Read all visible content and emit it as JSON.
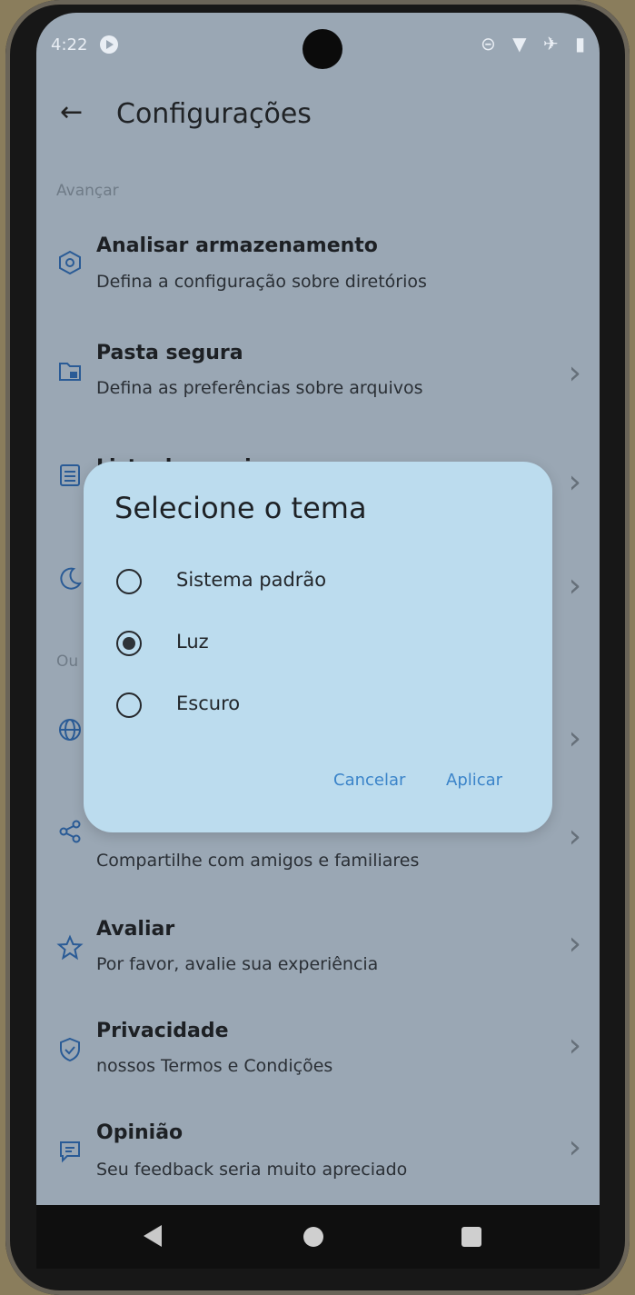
{
  "status": {
    "time": "4:22",
    "icons": "⊝ ▼ ✈ ▮"
  },
  "appbar": {
    "back": "←",
    "title": "Configurações"
  },
  "sections": {
    "advanced": "Avançar",
    "others": "Ou"
  },
  "rows": [
    {
      "title": "Analisar armazenamento",
      "subtitle": "Defina a configuração sobre diretórios",
      "icon": "storage-scan-icon"
    },
    {
      "title": "Pasta segura",
      "subtitle": "Defina as preferências sobre arquivos",
      "icon": "secure-folder-icon"
    },
    {
      "title": "Lista de arquivos",
      "subtitle": "",
      "icon": "file-list-icon"
    },
    {
      "title": "",
      "subtitle": "",
      "icon": "moon-icon"
    },
    {
      "title": "",
      "subtitle": "",
      "icon": "globe-icon"
    },
    {
      "title": "",
      "subtitle": "Compartilhe com amigos e familiares",
      "icon": "share-icon"
    },
    {
      "title": "Avaliar",
      "subtitle": "Por favor, avalie sua experiência",
      "icon": "star-icon"
    },
    {
      "title": "Privacidade",
      "subtitle": "nossos Termos e Condições",
      "icon": "shield-icon"
    },
    {
      "title": "Opinião",
      "subtitle": "Seu feedback seria muito apreciado",
      "icon": "feedback-icon"
    }
  ],
  "dialog": {
    "title": "Selecione o tema",
    "options": [
      "Sistema padrão",
      "Luz",
      "Escuro"
    ],
    "selected": "Luz",
    "cancel": "Cancelar",
    "apply": "Aplicar"
  },
  "colors": {
    "accent": "#3b84c9",
    "dialog_bg": "#bcdcee",
    "scrim_bg": "#9aa7b4"
  }
}
